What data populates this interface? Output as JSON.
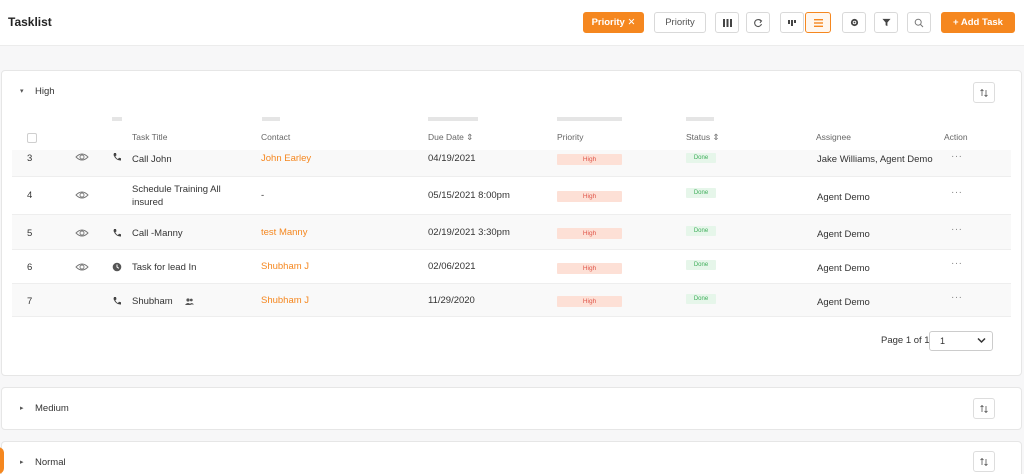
{
  "header": {
    "title": "Tasklist",
    "filter_chip": "Priority ✕",
    "group_by_label": "Priority",
    "add_task_label": "+ Add Task"
  },
  "groups": [
    {
      "label": "High",
      "caret": "▾",
      "expanded": true
    },
    {
      "label": "Medium",
      "caret": "▸",
      "expanded": false
    },
    {
      "label": "Normal",
      "caret": "▸",
      "expanded": false
    }
  ],
  "table": {
    "columns": [
      "Task Title",
      "Contact",
      "Due Date ⇕",
      "Priority",
      "Status ⇕",
      "Assignee",
      "Action"
    ],
    "rows": [
      {
        "num": "3",
        "eye": true,
        "icon": "phone-icon",
        "title": "Call John",
        "contact": "John Earley",
        "due": "04/19/2021",
        "priority": "High",
        "status": "Done",
        "assignee": "Jake Williams, Agent Demo",
        "action": "···"
      },
      {
        "num": "4",
        "eye": true,
        "icon": "",
        "title_line1": "Schedule Training All",
        "title_line2": "insured",
        "contact": "-",
        "due": "05/15/2021 8:00pm",
        "priority": "High",
        "status": "Done",
        "assignee": "Agent Demo",
        "action": "···"
      },
      {
        "num": "5",
        "eye": true,
        "icon": "phone-icon",
        "title": "Call -Manny",
        "contact": "test Manny",
        "due": "02/19/2021 3:30pm",
        "priority": "High",
        "status": "Done",
        "assignee": "Agent Demo",
        "action": "···"
      },
      {
        "num": "6",
        "eye": true,
        "icon": "clock-icon",
        "title": "Task for lead In",
        "contact": "Shubham J",
        "due": "02/06/2021",
        "priority": "High",
        "status": "Done",
        "assignee": "Agent Demo",
        "action": "···"
      },
      {
        "num": "7",
        "eye": false,
        "icon": "phone-icon",
        "title": "Shubham",
        "contact": "Shubham J",
        "due": "11/29/2020",
        "priority": "High",
        "status": "Done",
        "assignee": "Agent Demo",
        "action": "···"
      }
    ]
  },
  "pagination": {
    "label": "Page 1 of 1",
    "selected": "1"
  },
  "colors": {
    "accent": "#f5871f",
    "priority_bg": "#fde0d6",
    "status_bg": "#e6f6ea"
  }
}
